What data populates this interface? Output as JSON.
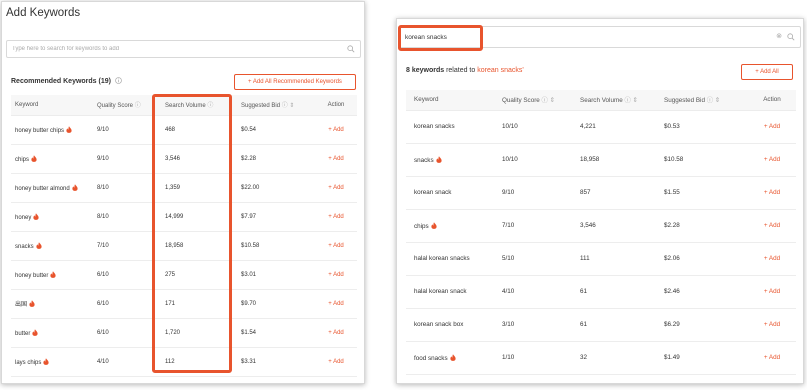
{
  "left": {
    "title": "Add Keywords",
    "search_placeholder": "Type here to search for keywords to add",
    "recommended_label": "Recommended Keywords (19)",
    "add_all_label": "+ Add All Recommended Keywords",
    "columns": [
      "Keyword",
      "Quality Score",
      "Search Volume",
      "Suggested Bid",
      "Action"
    ],
    "rows": [
      {
        "keyword": "honey butter chips",
        "hot": true,
        "quality": "9/10",
        "volume": "468",
        "bid": "$0.54",
        "action": "+ Add"
      },
      {
        "keyword": "chips",
        "hot": true,
        "quality": "9/10",
        "volume": "3,546",
        "bid": "$2.28",
        "action": "+ Add"
      },
      {
        "keyword": "honey butter almond",
        "hot": true,
        "quality": "8/10",
        "volume": "1,359",
        "bid": "$22.00",
        "action": "+ Add"
      },
      {
        "keyword": "honey",
        "hot": true,
        "quality": "8/10",
        "volume": "14,999",
        "bid": "$7.97",
        "action": "+ Add"
      },
      {
        "keyword": "snacks",
        "hot": true,
        "quality": "7/10",
        "volume": "18,958",
        "bid": "$10.58",
        "action": "+ Add"
      },
      {
        "keyword": "honey butter",
        "hot": true,
        "quality": "6/10",
        "volume": "275",
        "bid": "$3.01",
        "action": "+ Add"
      },
      {
        "keyword": "出国",
        "hot": true,
        "quality": "6/10",
        "volume": "171",
        "bid": "$9.70",
        "action": "+ Add"
      },
      {
        "keyword": "butter",
        "hot": true,
        "quality": "6/10",
        "volume": "1,720",
        "bid": "$1.54",
        "action": "+ Add"
      },
      {
        "keyword": "lays chips",
        "hot": true,
        "quality": "4/10",
        "volume": "112",
        "bid": "$3.31",
        "action": "+ Add"
      }
    ]
  },
  "right": {
    "search_value": "korean snacks",
    "results_prefix": "8 keywords",
    "results_middle": " related to ",
    "results_query": "korean snacks",
    "results_suffix": "'",
    "add_all_label": "+ Add All",
    "columns": [
      "Keyword",
      "Quality Score",
      "Search Volume",
      "Suggested Bid",
      "Action"
    ],
    "rows": [
      {
        "keyword": "korean snacks",
        "hot": false,
        "quality": "10/10",
        "volume": "4,221",
        "bid": "$0.53",
        "action": "+ Add"
      },
      {
        "keyword": "snacks",
        "hot": true,
        "quality": "10/10",
        "volume": "18,958",
        "bid": "$10.58",
        "action": "+ Add"
      },
      {
        "keyword": "korean snack",
        "hot": false,
        "quality": "9/10",
        "volume": "857",
        "bid": "$1.55",
        "action": "+ Add"
      },
      {
        "keyword": "chips",
        "hot": true,
        "quality": "7/10",
        "volume": "3,546",
        "bid": "$2.28",
        "action": "+ Add"
      },
      {
        "keyword": "halal korean snacks",
        "hot": false,
        "quality": "5/10",
        "volume": "111",
        "bid": "$2.06",
        "action": "+ Add"
      },
      {
        "keyword": "halal korean snack",
        "hot": false,
        "quality": "4/10",
        "volume": "61",
        "bid": "$2.46",
        "action": "+ Add"
      },
      {
        "keyword": "korean snack box",
        "hot": false,
        "quality": "3/10",
        "volume": "61",
        "bid": "$6.29",
        "action": "+ Add"
      },
      {
        "keyword": "food snacks",
        "hot": true,
        "quality": "1/10",
        "volume": "32",
        "bid": "$1.49",
        "action": "+ Add"
      }
    ]
  },
  "icons": {
    "hot": "fire-icon",
    "info": "info-icon",
    "sort": "sort-icon",
    "search": "search-icon",
    "clear": "clear-icon"
  },
  "colors": {
    "accent": "#e8542d",
    "highlight": "#e8542d"
  }
}
